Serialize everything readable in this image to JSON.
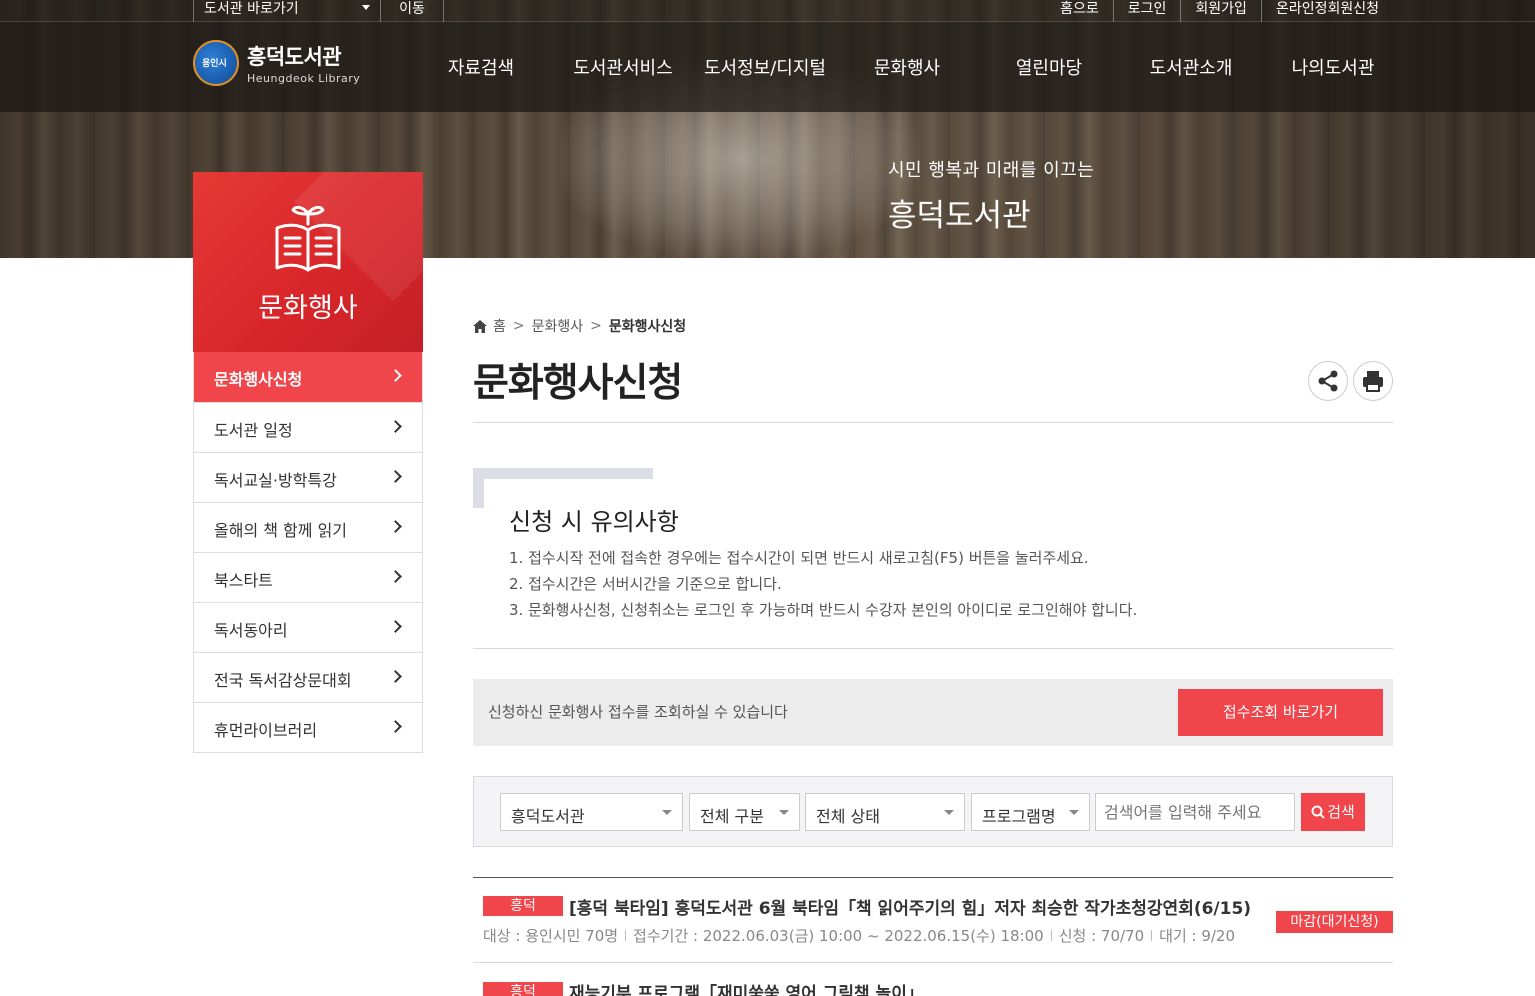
{
  "utility": {
    "quick_select": "도서관 바로가기",
    "go_label": "이동",
    "links": [
      "홈으로",
      "로그인",
      "회원가입",
      "온라인정회원신청"
    ]
  },
  "logo": {
    "emblem_text": "용인시",
    "name": "흥덕도서관",
    "sub": "Heungdeok Library"
  },
  "gnb": [
    "자료검색",
    "도서관서비스",
    "도서정보/디지털",
    "문화행사",
    "열린마당",
    "도서관소개",
    "나의도서관"
  ],
  "hero": {
    "line1": "시민 행복과 미래를 이끄는",
    "line2": "흥덕도서관"
  },
  "sidebar": {
    "title": "문화행사",
    "items": [
      {
        "label": "문화행사신청",
        "active": true
      },
      {
        "label": "도서관 일정"
      },
      {
        "label": "독서교실·방학특강"
      },
      {
        "label": "올해의 책 함께 읽기"
      },
      {
        "label": "북스타트"
      },
      {
        "label": "독서동아리"
      },
      {
        "label": "전국 독서감상문대회"
      },
      {
        "label": "휴먼라이브러리"
      }
    ]
  },
  "breadcrumb": {
    "home": "홈",
    "level1": "문화행사",
    "current": "문화행사신청"
  },
  "page_title": "문화행사신청",
  "notice": {
    "title": "신청 시 유의사항",
    "items": [
      "1. 접수시작 전에 접속한 경우에는 접수시간이 되면 반드시 새로고침(F5) 버튼을 눌러주세요.",
      "2. 접수시간은 서버시간을 기준으로 합니다.",
      "3. 문화행사신청, 신청취소는 로그인 후 가능하며 반드시 수강자 본인의 아이디로 로그인해야 합니다."
    ]
  },
  "inquiry": {
    "text": "신청하신 문화행사 접수를 조회하실 수 있습니다",
    "button": "접수조회 바로가기"
  },
  "search": {
    "library": "흥덕도서관",
    "category": "전체 구분",
    "status": "전체 상태",
    "field": "프로그램명",
    "placeholder": "검색어를 입력해 주세요",
    "button": "검색"
  },
  "events": [
    {
      "badge": "흥덕",
      "title": "[흥덕 북타임] 흥덕도서관 6월 북타임「책 읽어주기의 힘」저자 최승한 작가초청강연회(6/15)",
      "target": "대상 : 용인시민 70명",
      "period": "접수기간 : 2022.06.03(금) 10:00 ~ 2022.06.15(수) 18:00",
      "applied": "신청 : 70/70",
      "waiting": "대기 : 9/20",
      "status": "마감(대기신청)"
    },
    {
      "badge": "흥덕",
      "title": "재능기부 프로그램「재미쑥쑥 영어 그림책 놀이」"
    }
  ],
  "colors": {
    "accent": "#f0454a",
    "sidebar_head": "#d9262a"
  }
}
